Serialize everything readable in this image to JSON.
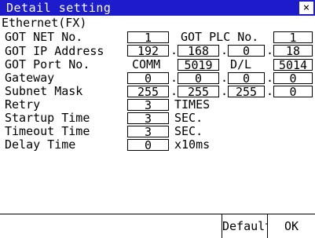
{
  "title": "Detail setting",
  "close_glyph": "×",
  "section": "Ethernet(FX)",
  "got_net_no": {
    "label": "GOT NET No.",
    "value": "1"
  },
  "got_plc_no": {
    "label": "GOT PLC No.",
    "value": "1"
  },
  "got_ip": {
    "label": "GOT IP Address",
    "octets": [
      "192",
      "168",
      "0",
      "18"
    ],
    "sep": "."
  },
  "got_port": {
    "label": "GOT Port No.",
    "comm_label": "COMM",
    "comm_value": "5019",
    "dl_label": "D/L",
    "dl_value": "5014"
  },
  "gateway": {
    "label": "Gateway",
    "octets": [
      "0",
      "0",
      "0",
      "0"
    ],
    "sep": "."
  },
  "subnet": {
    "label": "Subnet Mask",
    "octets": [
      "255",
      "255",
      "255",
      "0"
    ],
    "sep": "."
  },
  "retry": {
    "label": "Retry",
    "value": "3",
    "unit": "TIMES"
  },
  "startup": {
    "label": "Startup Time",
    "value": "3",
    "unit": "SEC."
  },
  "timeout": {
    "label": "Timeout Time",
    "value": "3",
    "unit": "SEC."
  },
  "delay": {
    "label": "Delay Time",
    "value": "0",
    "unit": "x10ms"
  },
  "buttons": {
    "default": "Default",
    "ok": "OK"
  }
}
